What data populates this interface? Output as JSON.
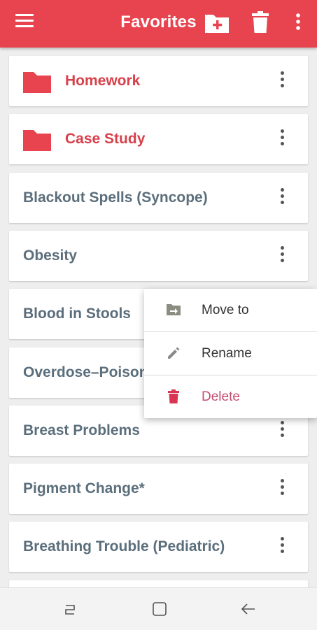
{
  "appbar": {
    "title": "Favorites",
    "menu_icon": "hamburger-menu-icon",
    "add_folder_icon": "add-folder-icon",
    "trash_icon": "trash-icon",
    "overflow_icon": "more-vert-icon",
    "background": "#e84450"
  },
  "list": {
    "items": [
      {
        "label": "Homework",
        "type": "folder"
      },
      {
        "label": "Case Study",
        "type": "folder"
      },
      {
        "label": "Blackout Spells (Syncope)",
        "type": "topic"
      },
      {
        "label": "Obesity",
        "type": "topic"
      },
      {
        "label": "Blood in Stools",
        "type": "topic"
      },
      {
        "label": "Overdose–Poisoning",
        "type": "topic"
      },
      {
        "label": "Breast Problems",
        "type": "topic"
      },
      {
        "label": "Pigment Change*",
        "type": "topic"
      },
      {
        "label": "Breathing Trouble (Pediatric)",
        "type": "topic"
      }
    ],
    "folder_color": "#d8404b",
    "topic_color": "#5b6e7b"
  },
  "popup_menu": {
    "items": [
      {
        "label": "Move to",
        "icon": "move-to-folder-icon"
      },
      {
        "label": "Rename",
        "icon": "pencil-icon"
      },
      {
        "label": "Delete",
        "icon": "trash-icon"
      }
    ],
    "delete_color": "#c24d72"
  },
  "navbar": {
    "recent_icon": "recent-apps-icon",
    "home_icon": "home-icon",
    "back_icon": "back-icon"
  }
}
